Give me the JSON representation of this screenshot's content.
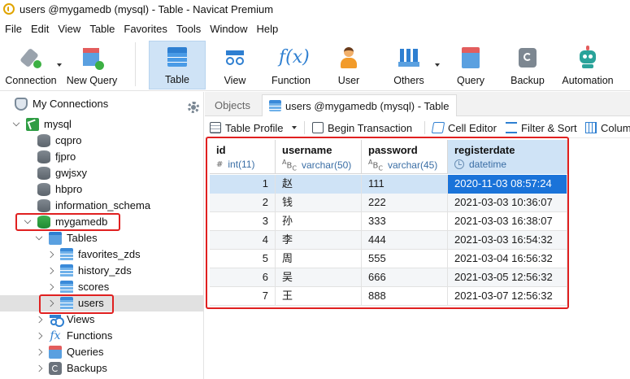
{
  "window": {
    "title": "users @mygamedb (mysql) - Table - Navicat Premium"
  },
  "menu": [
    "File",
    "Edit",
    "View",
    "Table",
    "Favorites",
    "Tools",
    "Window",
    "Help"
  ],
  "toolbar": {
    "connection": "Connection",
    "new_query": "New Query",
    "table": "Table",
    "view": "View",
    "function": "Function",
    "user": "User",
    "others": "Others",
    "query": "Query",
    "backup": "Backup",
    "automation": "Automation",
    "function_glyph": "f(x)"
  },
  "sidebar": {
    "root": "My Connections",
    "connection": "mysql",
    "databases": [
      "cqpro",
      "fjpro",
      "gwjsxy",
      "hbpro",
      "information_schema"
    ],
    "open_db": "mygamedb",
    "tables_folder": "Tables",
    "tables": [
      "favorites_zds",
      "history_zds",
      "scores",
      "users"
    ],
    "views": "Views",
    "functions": "Functions",
    "fx_glyph": "fx",
    "queries": "Queries",
    "backups": "Backups"
  },
  "tabs": {
    "objects": "Objects",
    "active": "users @mygamedb (mysql) - Table"
  },
  "subtoolbar": {
    "table_profile": "Table Profile",
    "begin_transaction": "Begin Transaction",
    "cell_editor": "Cell Editor",
    "filter_sort": "Filter & Sort",
    "columns": "Colum"
  },
  "grid": {
    "columns": [
      {
        "name": "id",
        "type": "int(11)",
        "glyph": "#"
      },
      {
        "name": "username",
        "type": "varchar(50)",
        "glyph": "ABC"
      },
      {
        "name": "password",
        "type": "varchar(45)",
        "glyph": "ABC"
      },
      {
        "name": "registerdate",
        "type": "datetime",
        "glyph": "clock"
      }
    ],
    "rows": [
      [
        "1",
        "赵",
        "111",
        "2020-11-03 08:57:24"
      ],
      [
        "2",
        "钱",
        "222",
        "2021-03-03 10:36:07"
      ],
      [
        "3",
        "孙",
        "333",
        "2021-03-03 16:38:07"
      ],
      [
        "4",
        "李",
        "444",
        "2021-03-03 16:54:32"
      ],
      [
        "5",
        "周",
        "555",
        "2021-03-04 16:56:32"
      ],
      [
        "6",
        "吴",
        "666",
        "2021-03-05 12:56:32"
      ],
      [
        "7",
        "王",
        "888",
        "2021-03-07 12:56:32"
      ]
    ]
  },
  "colors": {
    "highlight_border": "#e02020",
    "selection": "#1a73d9",
    "active_tab": "#cfe3f6"
  }
}
